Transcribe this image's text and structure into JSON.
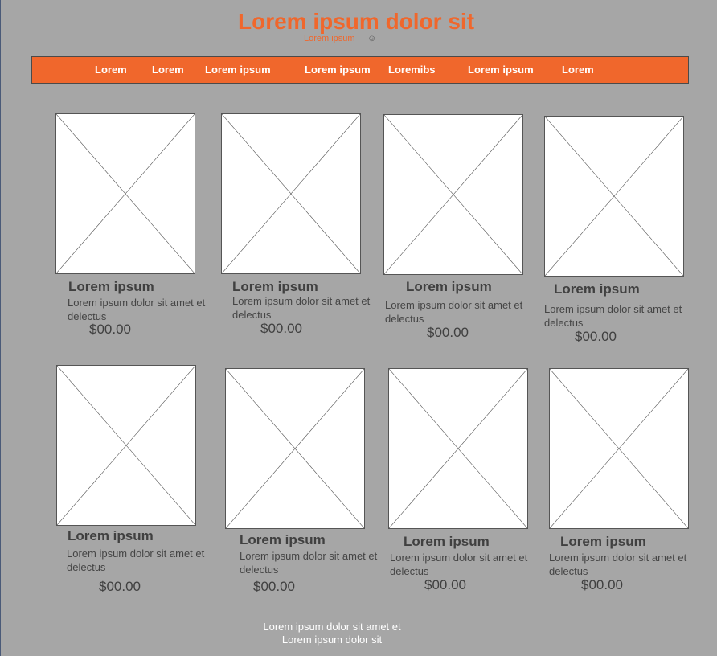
{
  "header": {
    "title": "Lorem ipsum dolor sit",
    "subtitle": "Lorem ipsum",
    "smiley": "☺"
  },
  "nav": {
    "items": [
      {
        "label": "Lorem"
      },
      {
        "label": "Lorem"
      },
      {
        "label": "Lorem ipsum"
      },
      {
        "label": "Lorem ipsum"
      },
      {
        "label": "Loremibs"
      },
      {
        "label": "Lorem ipsum"
      },
      {
        "label": "Lorem"
      }
    ]
  },
  "products": [
    {
      "name": "Lorem ipsum",
      "description": "Lorem ipsum dolor sit amet et delectus",
      "price": "$00.00"
    },
    {
      "name": "Lorem ipsum",
      "description": "Lorem ipsum dolor sit amet et delectus",
      "price": "$00.00"
    },
    {
      "name": "Lorem ipsum",
      "description": "Lorem ipsum dolor sit amet et delectus",
      "price": "$00.00"
    },
    {
      "name": "Lorem ipsum",
      "description": "Lorem ipsum dolor sit amet et delectus",
      "price": "$00.00"
    },
    {
      "name": "Lorem ipsum",
      "description": "Lorem ipsum dolor sit amet et delectus",
      "price": "$00.00"
    },
    {
      "name": "Lorem ipsum",
      "description": "Lorem ipsum dolor sit amet et delectus",
      "price": "$00.00"
    },
    {
      "name": "Lorem ipsum",
      "description": "Lorem ipsum dolor sit amet et delectus",
      "price": "$00.00"
    },
    {
      "name": "Lorem ipsum",
      "description": "Lorem ipsum dolor sit amet et delectus",
      "price": "$00.00"
    }
  ],
  "footer": {
    "line1": "Lorem ipsum dolor sit amet et",
    "line2": "Lorem ipsum dolor sit"
  },
  "colors": {
    "accent": "#f0672c",
    "background": "#a6a6a6",
    "footer_text": "#ffffff"
  }
}
